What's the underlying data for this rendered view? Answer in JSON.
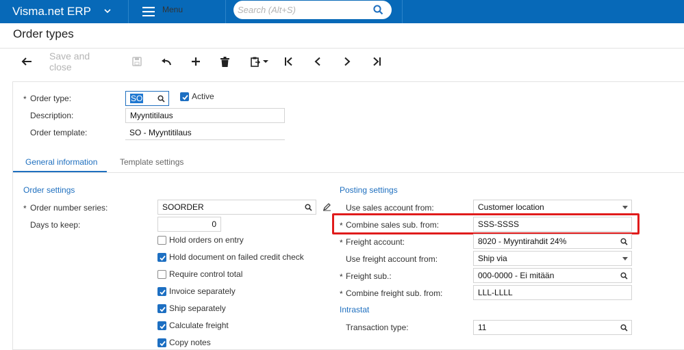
{
  "app": {
    "brand": "Visma.net ERP",
    "menu_label": "Menu",
    "search_placeholder": "Search (Alt+S)"
  },
  "page": {
    "title": "Order types"
  },
  "toolbar": {
    "save_close_label": "Save and close"
  },
  "header_form": {
    "order_type_label": "Order type:",
    "order_type_value": "SO",
    "active_label": "Active",
    "active_checked": true,
    "description_label": "Description:",
    "description_value": "Myyntitilaus",
    "template_label": "Order template:",
    "template_value": "SO - Myyntitilaus"
  },
  "tabs": [
    {
      "label": "General information",
      "active": true
    },
    {
      "label": "Template settings",
      "active": false
    }
  ],
  "order_settings": {
    "title": "Order settings",
    "number_series_label": "Order number series:",
    "number_series_value": "SOORDER",
    "days_to_keep_label": "Days to keep:",
    "days_to_keep_value": "0",
    "checkboxes": [
      {
        "label": "Hold orders on entry",
        "checked": false
      },
      {
        "label": "Hold document on failed credit check",
        "checked": true
      },
      {
        "label": "Require control total",
        "checked": false
      },
      {
        "label": "Invoice separately",
        "checked": true
      },
      {
        "label": "Ship separately",
        "checked": true
      },
      {
        "label": "Calculate freight",
        "checked": true
      },
      {
        "label": "Copy notes",
        "checked": true
      }
    ]
  },
  "posting_settings": {
    "title": "Posting settings",
    "use_sales_account_label": "Use sales account from:",
    "use_sales_account_value": "Customer location",
    "combine_sales_sub_label": "Combine sales sub. from:",
    "combine_sales_sub_value": "SSS-SSSS",
    "freight_account_label": "Freight account:",
    "freight_account_value": "8020 - Myyntirahdit 24%",
    "use_freight_account_label": "Use freight account from:",
    "use_freight_account_value": "Ship via",
    "freight_sub_label": "Freight sub.:",
    "freight_sub_value": "000-0000 - Ei mitään",
    "combine_freight_sub_label": "Combine freight sub. from:",
    "combine_freight_sub_value": "LLL-LLLL"
  },
  "intrastat": {
    "title": "Intrastat",
    "transaction_type_label": "Transaction type:",
    "transaction_type_value": "11"
  },
  "colors": {
    "topbar": "#0769b8",
    "accent": "#1e6fbf",
    "highlight": "#e01b1b"
  }
}
